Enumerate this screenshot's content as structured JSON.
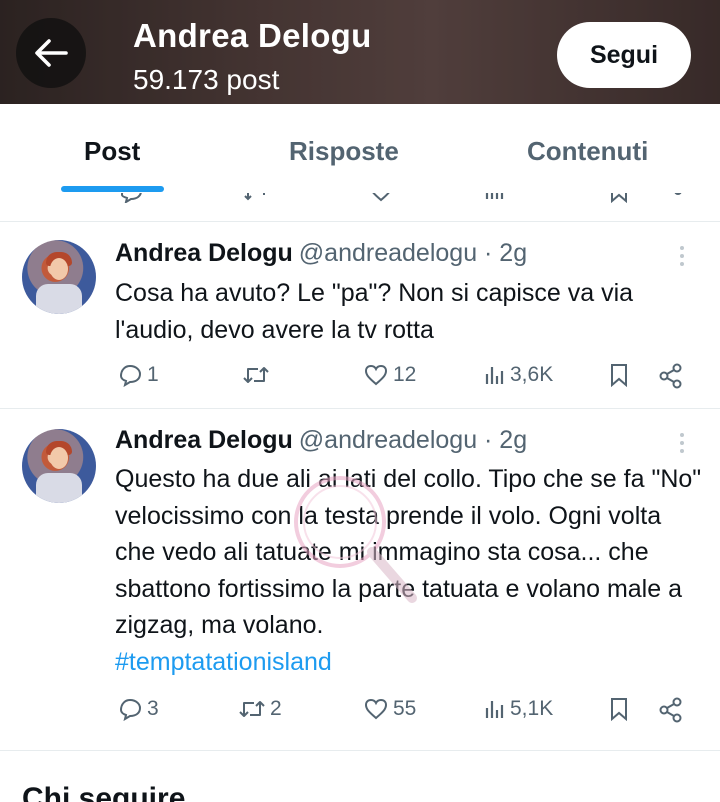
{
  "header": {
    "title": "Andrea Delogu",
    "subtitle": "59.173 post",
    "follow_label": "Segui"
  },
  "tabs": [
    {
      "label": "Post",
      "active": true
    },
    {
      "label": "Risposte",
      "active": false
    },
    {
      "label": "Contenuti",
      "active": false
    }
  ],
  "tweets": [
    {
      "name": "Andrea Delogu",
      "handle": "@andreadelogu · 2g",
      "text": "Cosa ha avuto? Le \"pa\"? Non si capisce va via l'audio, devo avere la tv rotta",
      "hashtag": "",
      "replies": "1",
      "retweets": "",
      "likes": "12",
      "views": "3,6K"
    },
    {
      "name": "Andrea Delogu",
      "handle": "@andreadelogu · 2g",
      "text": "Questo ha due ali ai lati del collo. Tipo che se fa \"No\" velocissimo con la testa prende il volo. Ogni volta che vedo ali tatuate mi immagino sta cosa... che sbattono fortissimo la parte tatuata e volano male a zigzag, ma volano.",
      "hashtag": "#temptatationisland",
      "replies": "3",
      "retweets": "2",
      "likes": "55",
      "views": "5,1K"
    }
  ],
  "footer": {
    "heading": "Chi seguire"
  },
  "colors": {
    "accent": "#1d9bf0",
    "text": "#0f1419",
    "muted": "#536471"
  }
}
